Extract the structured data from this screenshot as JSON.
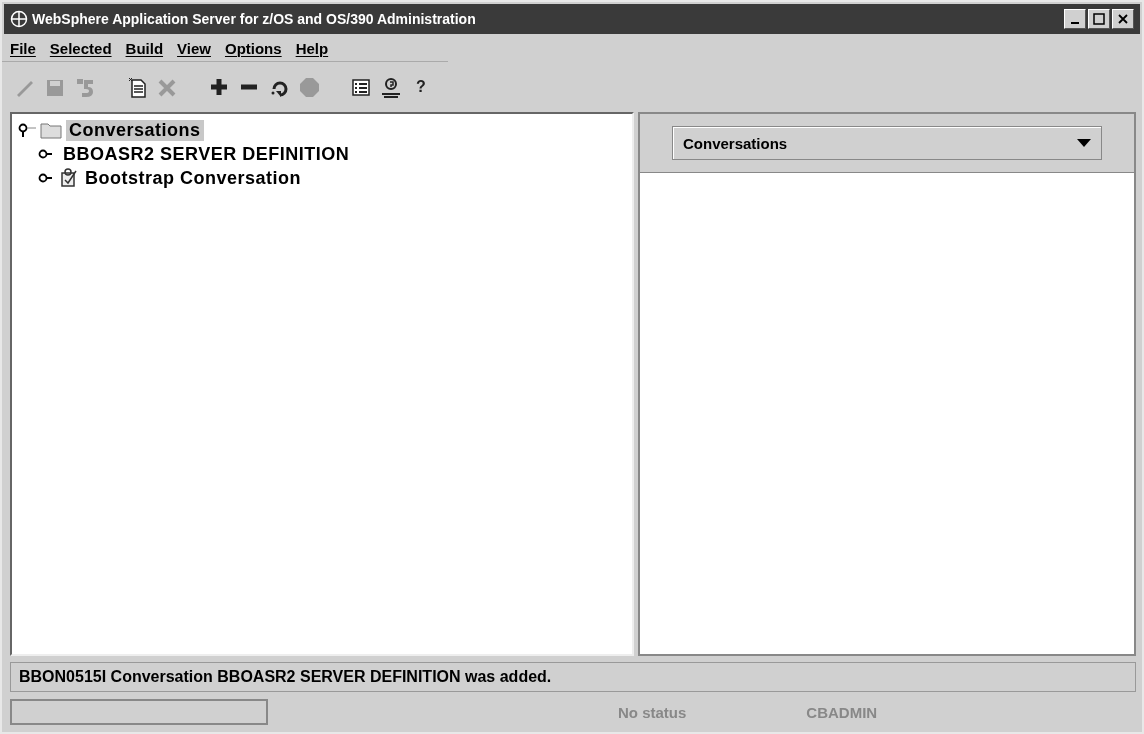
{
  "window": {
    "title": "WebSphere Application Server for z/OS and OS/390 Administration"
  },
  "menu": [
    "File",
    "Selected",
    "Build",
    "View",
    "Options",
    "Help"
  ],
  "toolbar": [
    {
      "kind": "pencil",
      "disabled": true
    },
    {
      "kind": "save",
      "disabled": true
    },
    {
      "kind": "undo",
      "disabled": true
    },
    {
      "kind": "sep"
    },
    {
      "kind": "new",
      "disabled": false
    },
    {
      "kind": "delete",
      "disabled": true
    },
    {
      "kind": "sep"
    },
    {
      "kind": "plus",
      "disabled": false
    },
    {
      "kind": "minus",
      "disabled": false
    },
    {
      "kind": "refresh",
      "disabled": false
    },
    {
      "kind": "stop",
      "disabled": true
    },
    {
      "kind": "sep"
    },
    {
      "kind": "list",
      "disabled": false
    },
    {
      "kind": "person",
      "disabled": false
    },
    {
      "kind": "help",
      "disabled": false,
      "label": "?"
    }
  ],
  "tree": {
    "label": "Conversations",
    "expanded": true,
    "selected": true,
    "children": [
      {
        "label": "BBOASR2 SERVER DEFINITION",
        "expanded": false,
        "selected": false,
        "kind": "plain"
      },
      {
        "label": "Bootstrap Conversation",
        "expanded": false,
        "selected": false,
        "kind": "clipboard"
      }
    ]
  },
  "view_select": {
    "value": "Conversations"
  },
  "message": "BBON0515I Conversation BBOASR2 SERVER DEFINITION was added.",
  "status_bar": {
    "status": "No status",
    "user": "CBADMIN"
  }
}
